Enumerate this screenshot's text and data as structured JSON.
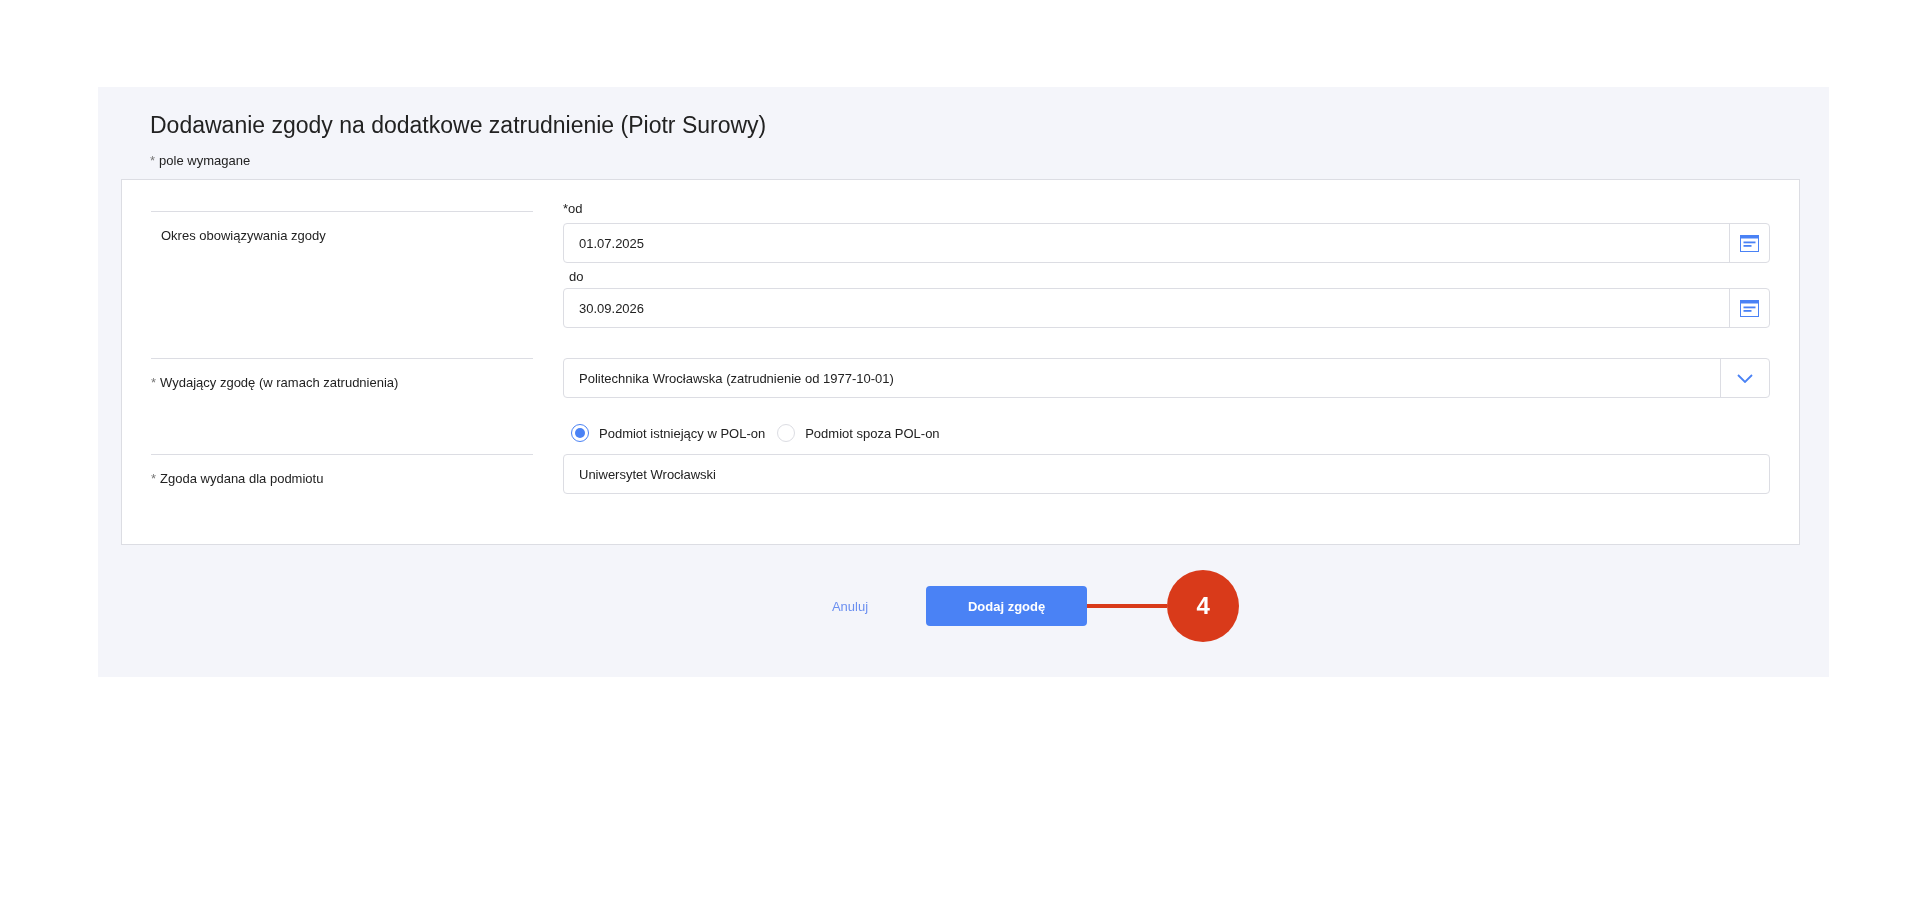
{
  "title": "Dodawanie zgody na dodatkowe zatrudnienie (Piotr Surowy)",
  "required_note": {
    "mark": "*",
    "text": "pole wymagane"
  },
  "rows": [
    {
      "kind": "dates",
      "label": "Okres obowiązywania zgody",
      "fields": [
        {
          "label": "*od",
          "value": "01.07.2025"
        },
        {
          "label": "do",
          "value": "30.09.2026"
        }
      ]
    },
    {
      "kind": "select",
      "mark": "*",
      "label": "Wydający zgodę (w ramach zatrudnienia)",
      "value": "Politechnika Wrocławska (zatrudnienie od 1977-10-01)",
      "options": [
        {
          "label": "Podmiot istniejący w POL-on",
          "selected": true
        },
        {
          "label": "Podmiot spoza POL-on",
          "selected": false
        }
      ]
    },
    {
      "kind": "text",
      "mark": "*",
      "label": "Zgoda wydana dla podmiotu",
      "value": "Uniwersytet Wrocławski"
    }
  ],
  "buttons": {
    "cancel": "Anuluj",
    "submit": "Dodaj zgodę"
  },
  "callout": {
    "number": "4"
  }
}
